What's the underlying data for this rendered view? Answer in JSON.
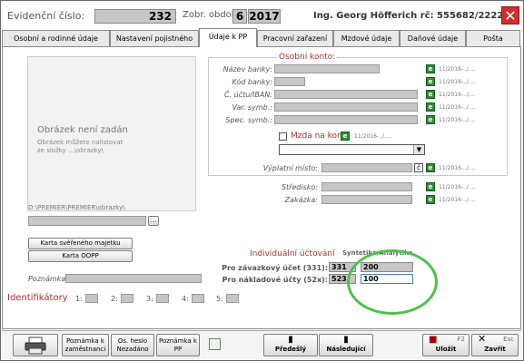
{
  "header": {
    "evidencni_label": "Evidenční číslo:",
    "evidencni_value": "232",
    "obdobi_label": "Zobr. období:",
    "obdobi_month": "6",
    "obdobi_year": "2017",
    "employee": "Ing. Georg Höfferich rč: 555682/2222"
  },
  "tabs": [
    "Osobní a rodinné údaje",
    "Nastavení pojistného",
    "Údaje k PP",
    "Pracovní zařazení",
    "Mzdové údaje",
    "Daňové údaje",
    "Pošta"
  ],
  "image_panel": {
    "title": "Obrázek není zadán",
    "hint_line1": "Obrázek můžete nalistovat",
    "hint_line2": "ze složky ...\\obrazky\\",
    "path": "D:\\PREMIER\\PREMIER\\obrazky\\",
    "browse_label": "..."
  },
  "osobni_konto": {
    "title": "Osobní konto:",
    "fields": [
      "Název banky:",
      "Kód banky:",
      "Č. účtu/IBAN:",
      "Var. symb.:",
      "Spec. symb.:"
    ],
    "dates": [
      "11/2016-../....",
      "11/2016-../....",
      "11/2016-../....",
      "11/2016-../....",
      "11/2016-../...."
    ],
    "mzda_label": "Mzda na konto",
    "mzda_date": "11/2016-../....",
    "vyplatni_label": "Výplatní místo:",
    "vyplatni_date": "11/2016-../....",
    "c_label": "č",
    "edit_glyph": "e"
  },
  "stredisko": {
    "stredisko_label": "Středisko:",
    "zakazka_label": "Zakázka:",
    "stredisko_date": "11/2016-../....",
    "zakazka_date": "11/2016-../...."
  },
  "buttons": {
    "karta_majetku": "Karta svěřeného majetku",
    "karta_oopp": "Karta OOPP"
  },
  "poznamka_label": "Poznámka:",
  "individualni": {
    "title": "Individuální účtování",
    "header": "Syntetika/Analytika",
    "row1_label": "Pro závazkový účet (331):",
    "row1_synt": "331",
    "row1_anal": "200",
    "row2_label": "Pro nákladové účty (52x):",
    "row2_synt": "523",
    "row2_anal": "100"
  },
  "identifikatory": {
    "title": "Identifikátory",
    "items": [
      "1:",
      "2:",
      "3:",
      "4:",
      "5:"
    ]
  },
  "footer": {
    "poznamka_zam": "Poznámka k zaměstnanci",
    "os_heslo": "Os. heslo Nezadáno",
    "poznamka_pp": "Poznámka k PP",
    "predesly": "Předešlý",
    "nasledujici": "Následující",
    "ulozit": "Uložit",
    "ulozit_key": "F2",
    "zavrit": "Zavřít",
    "zavrit_key": "Esc"
  }
}
